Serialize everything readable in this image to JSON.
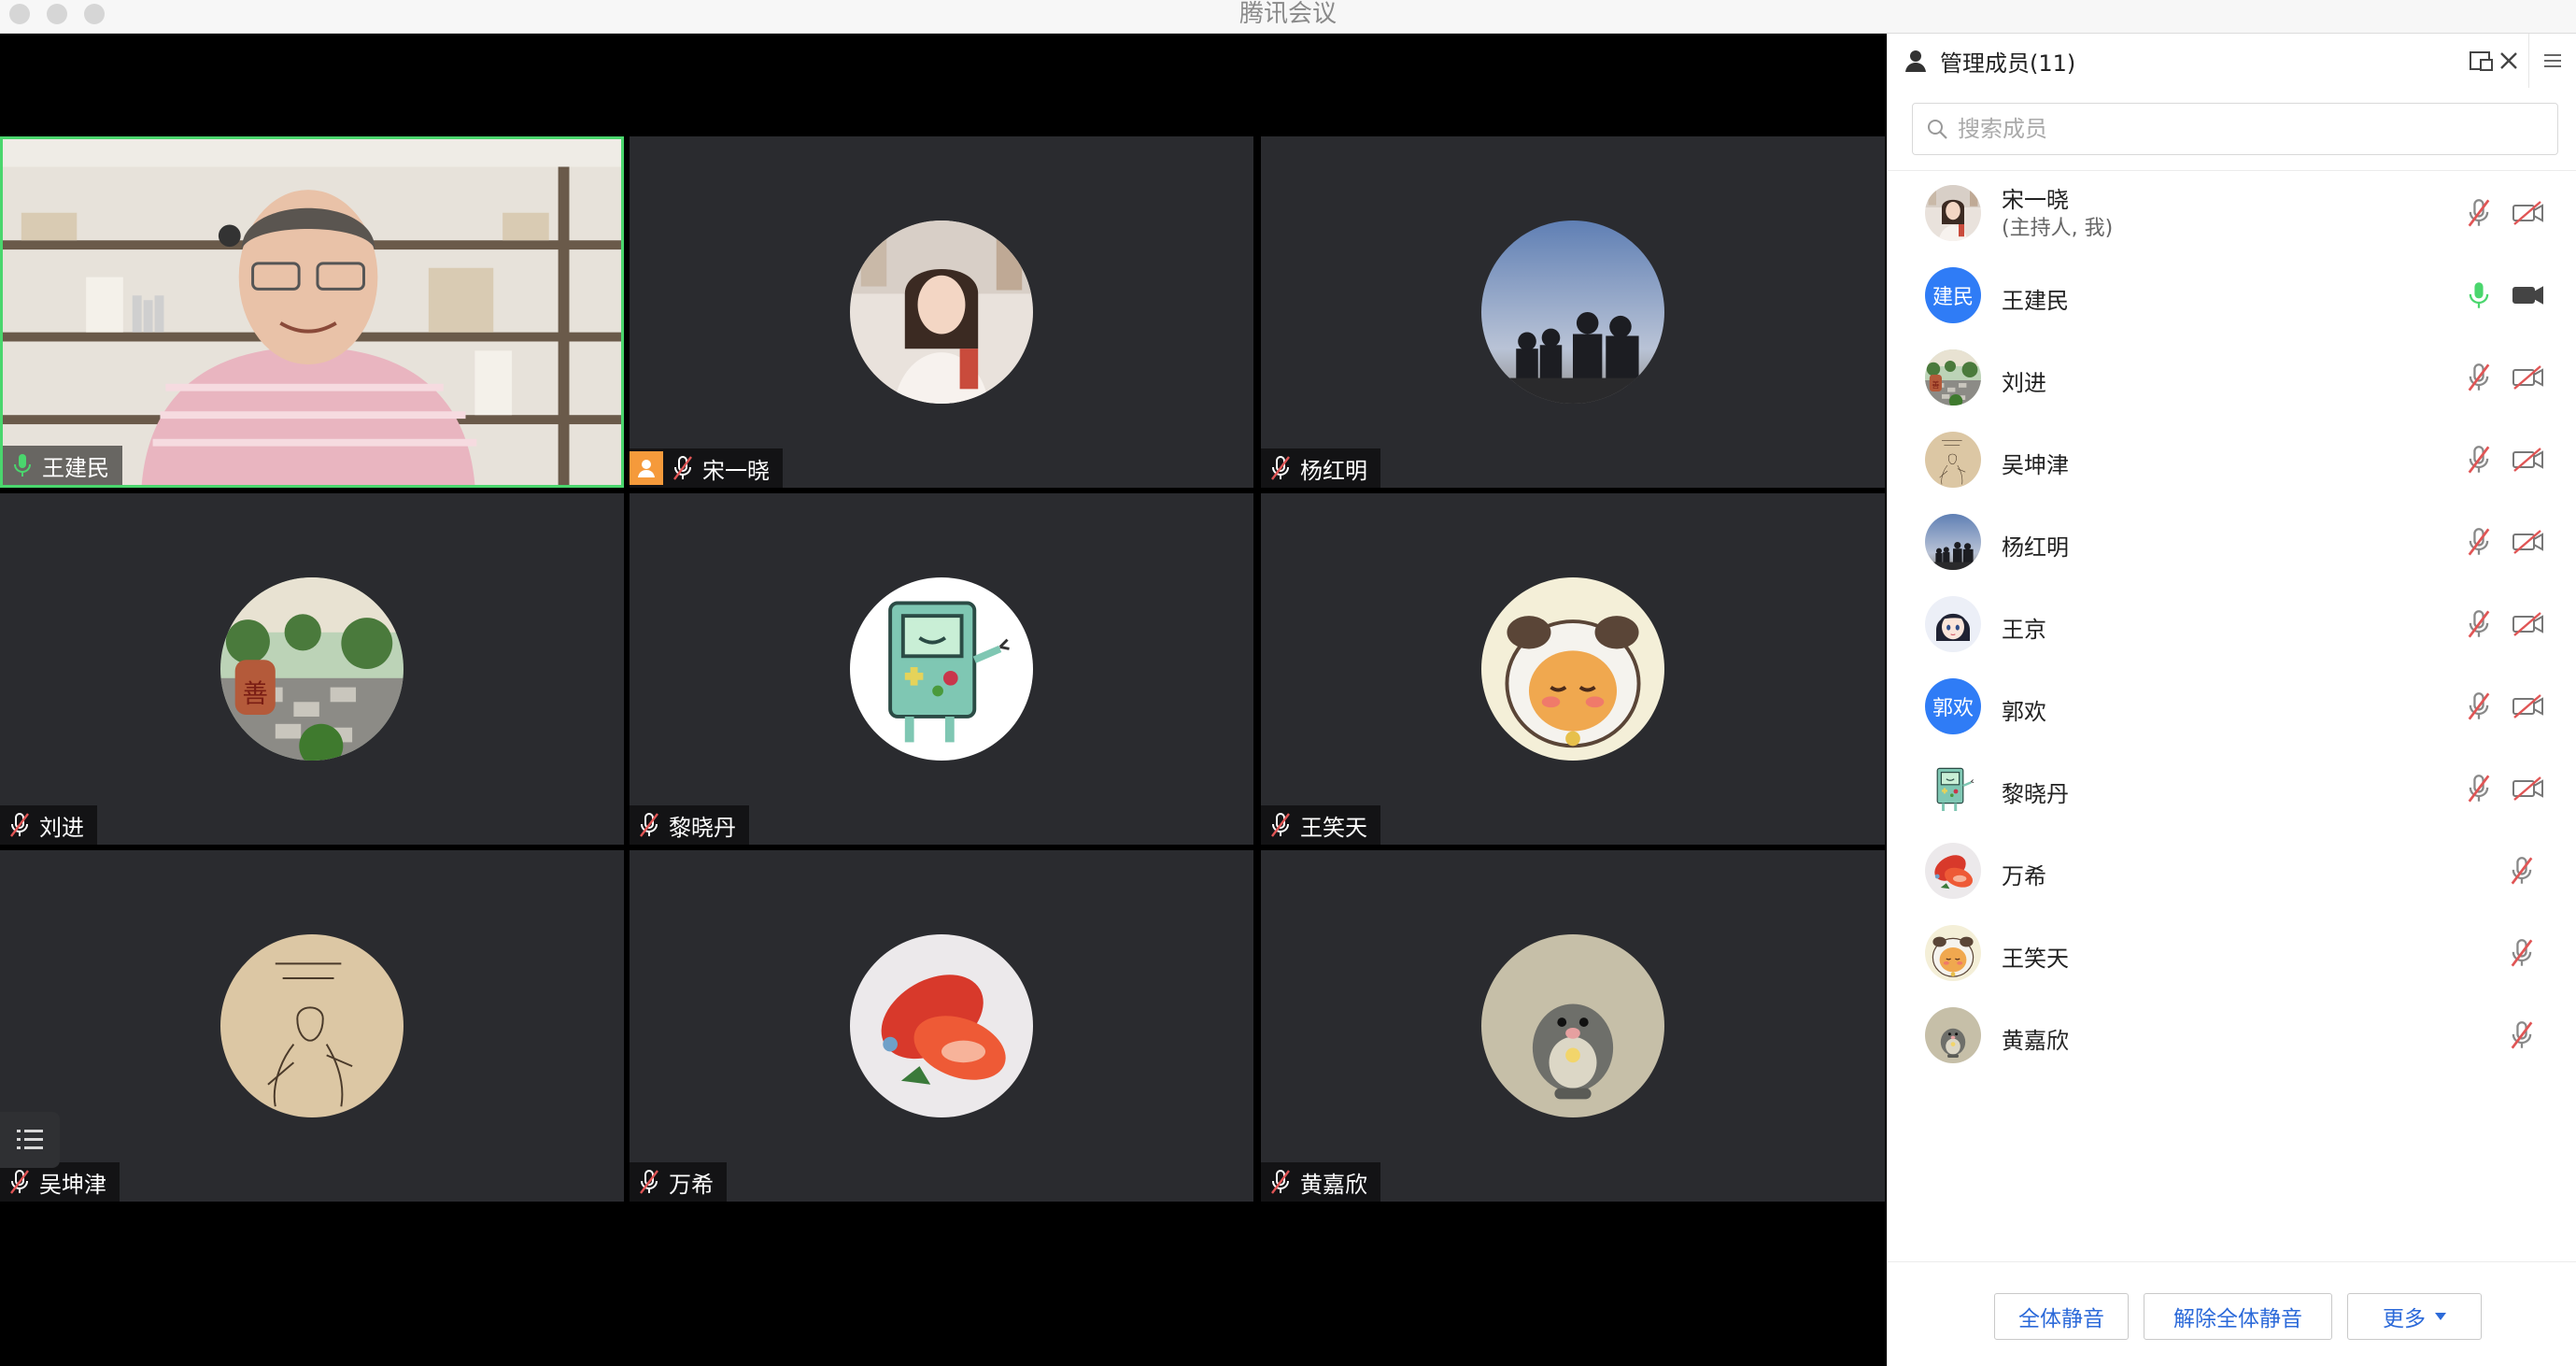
{
  "window": {
    "title": "腾讯会议"
  },
  "tiles": [
    {
      "name": "王建民",
      "mic": "on",
      "active": true,
      "kind": "camera"
    },
    {
      "name": "宋一晓",
      "mic": "off",
      "host": true,
      "kind": "avatar",
      "avatar": "woman-portrait"
    },
    {
      "name": "杨红明",
      "mic": "off",
      "kind": "avatar",
      "avatar": "silhouettes-sky"
    },
    {
      "name": "刘进",
      "mic": "off",
      "kind": "avatar",
      "avatar": "garden-photo"
    },
    {
      "name": "黎晓丹",
      "mic": "off",
      "kind": "avatar",
      "avatar": "bmo-cartoon"
    },
    {
      "name": "王笑天",
      "mic": "off",
      "kind": "avatar",
      "avatar": "puppy-cartoon"
    },
    {
      "name": "吴坤津",
      "mic": "off",
      "kind": "avatar",
      "avatar": "sketch-illustration"
    },
    {
      "name": "万希",
      "mic": "off",
      "kind": "avatar",
      "avatar": "strawberry-photo"
    },
    {
      "name": "黄嘉欣",
      "mic": "off",
      "kind": "avatar",
      "avatar": "mole-cartoon"
    }
  ],
  "panel": {
    "title": "管理成员(11)",
    "search_placeholder": "搜索成员",
    "members": [
      {
        "name": "宋一晓",
        "note": "(主持人, 我)",
        "avatar": "woman-portrait",
        "mic": "off",
        "cam": "off"
      },
      {
        "name": "王建民",
        "avatar_text": "建民",
        "avatar_color": "#2f7cf6",
        "mic": "on",
        "cam": "on"
      },
      {
        "name": "刘进",
        "avatar": "garden-photo",
        "mic": "off",
        "cam": "off"
      },
      {
        "name": "吴坤津",
        "avatar": "sketch-illustration",
        "mic": "off",
        "cam": "off"
      },
      {
        "name": "杨红明",
        "avatar": "silhouettes-sky",
        "mic": "off",
        "cam": "off"
      },
      {
        "name": "王京",
        "avatar": "anime-girl",
        "mic": "off",
        "cam": "off"
      },
      {
        "name": "郭欢",
        "avatar_text": "郭欢",
        "avatar_color": "#2f7cf6",
        "mic": "off",
        "cam": "off"
      },
      {
        "name": "黎晓丹",
        "avatar": "bmo-cartoon",
        "mic": "off",
        "cam": "off"
      },
      {
        "name": "万希",
        "avatar": "strawberry-photo",
        "mic": "off"
      },
      {
        "name": "王笑天",
        "avatar": "puppy-cartoon",
        "mic": "off"
      },
      {
        "name": "黄嘉欣",
        "avatar": "mole-cartoon",
        "mic": "off"
      }
    ],
    "buttons": {
      "mute_all": "全体静音",
      "unmute_all": "解除全体静音",
      "more": "更多"
    }
  },
  "colors": {
    "accent": "#2c6ad9",
    "active_border": "#4ad66d",
    "mic_on": "#4ad66d",
    "muted": "#e05555"
  }
}
